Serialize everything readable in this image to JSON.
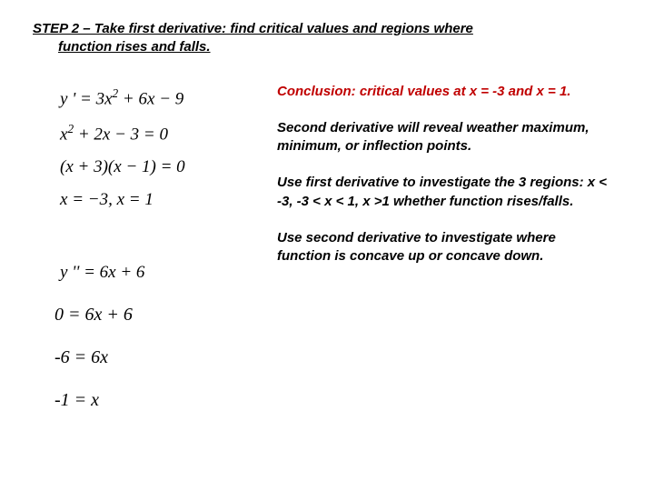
{
  "heading": {
    "line1": "STEP 2 –  Take first derivative: find critical values and regions where",
    "line2": "function rises and falls."
  },
  "math": {
    "eq1": "y ' = 3x² + 6x − 9",
    "eq2": "x² + 2x − 3 = 0",
    "eq3": "(x + 3)(x − 1) = 0",
    "eq4": "x = −3, x = 1",
    "eq5": "y '' = 6x + 6",
    "work1": "0 = 6x + 6",
    "work2": "-6 = 6x",
    "work3": "-1 = x"
  },
  "notes": {
    "n1": "Conclusion: critical values at x = -3 and x = 1.",
    "n2": "Second derivative will reveal weather  maximum, minimum, or inflection points.",
    "n3": "Use first derivative to investigate the 3 regions: x < -3, -3 < x < 1, x >1  whether function rises/falls.",
    "n4": "Use second derivative to investigate where function is concave up or concave down."
  }
}
